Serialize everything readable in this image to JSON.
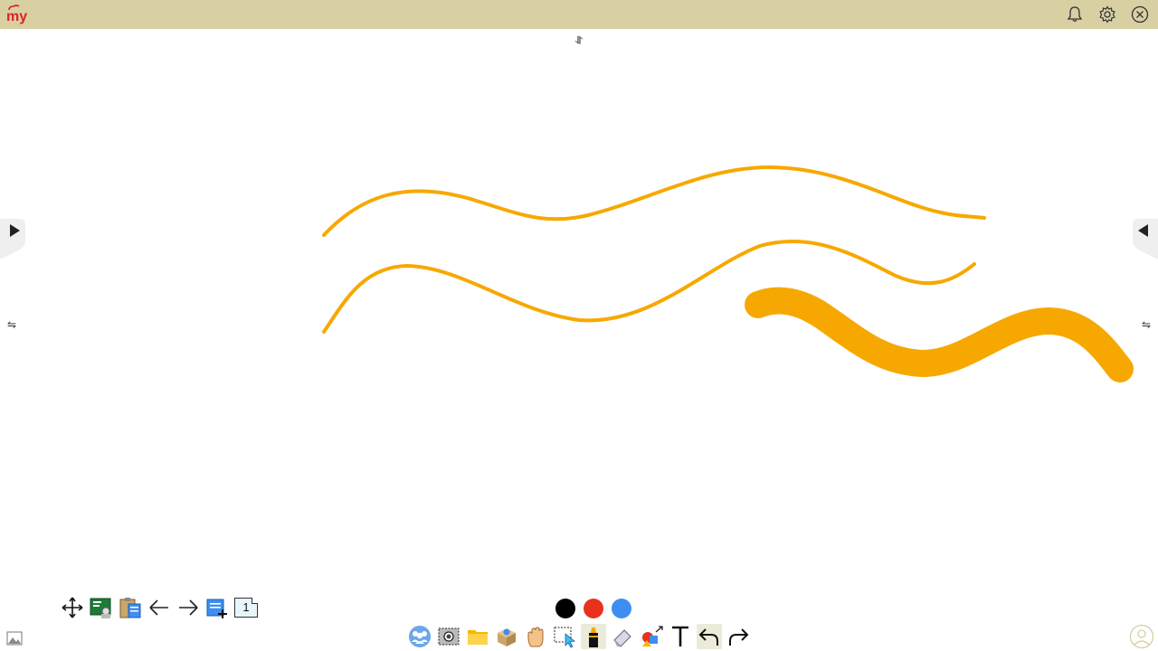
{
  "header": {
    "logo_text": "my",
    "notifications_icon": "bell-icon",
    "settings_icon": "gear-icon",
    "close_icon": "close-circle-icon",
    "background": "#d8cfa3"
  },
  "canvas": {
    "top_swap_glyph": "⥯",
    "left_swap_glyph": "⇋",
    "right_swap_glyph": "⇋",
    "stroke_color": "#f7a800"
  },
  "left_toolbar": {
    "tools": [
      "move-icon",
      "presentation-icon",
      "clipboard-icon",
      "arrow-left-icon",
      "arrow-right-icon",
      "add-page-icon"
    ],
    "page_number": "1"
  },
  "palette": {
    "colors": [
      "#000000",
      "#e8321e",
      "#3d8ef0"
    ]
  },
  "bottom_toolbar": {
    "tools": [
      "group-icon",
      "screenshot-icon",
      "folder-icon",
      "box-icon",
      "hand-icon",
      "select-icon",
      "marker-icon",
      "eraser-icon",
      "shapes-icon",
      "text-icon",
      "undo-icon",
      "redo-icon"
    ]
  }
}
